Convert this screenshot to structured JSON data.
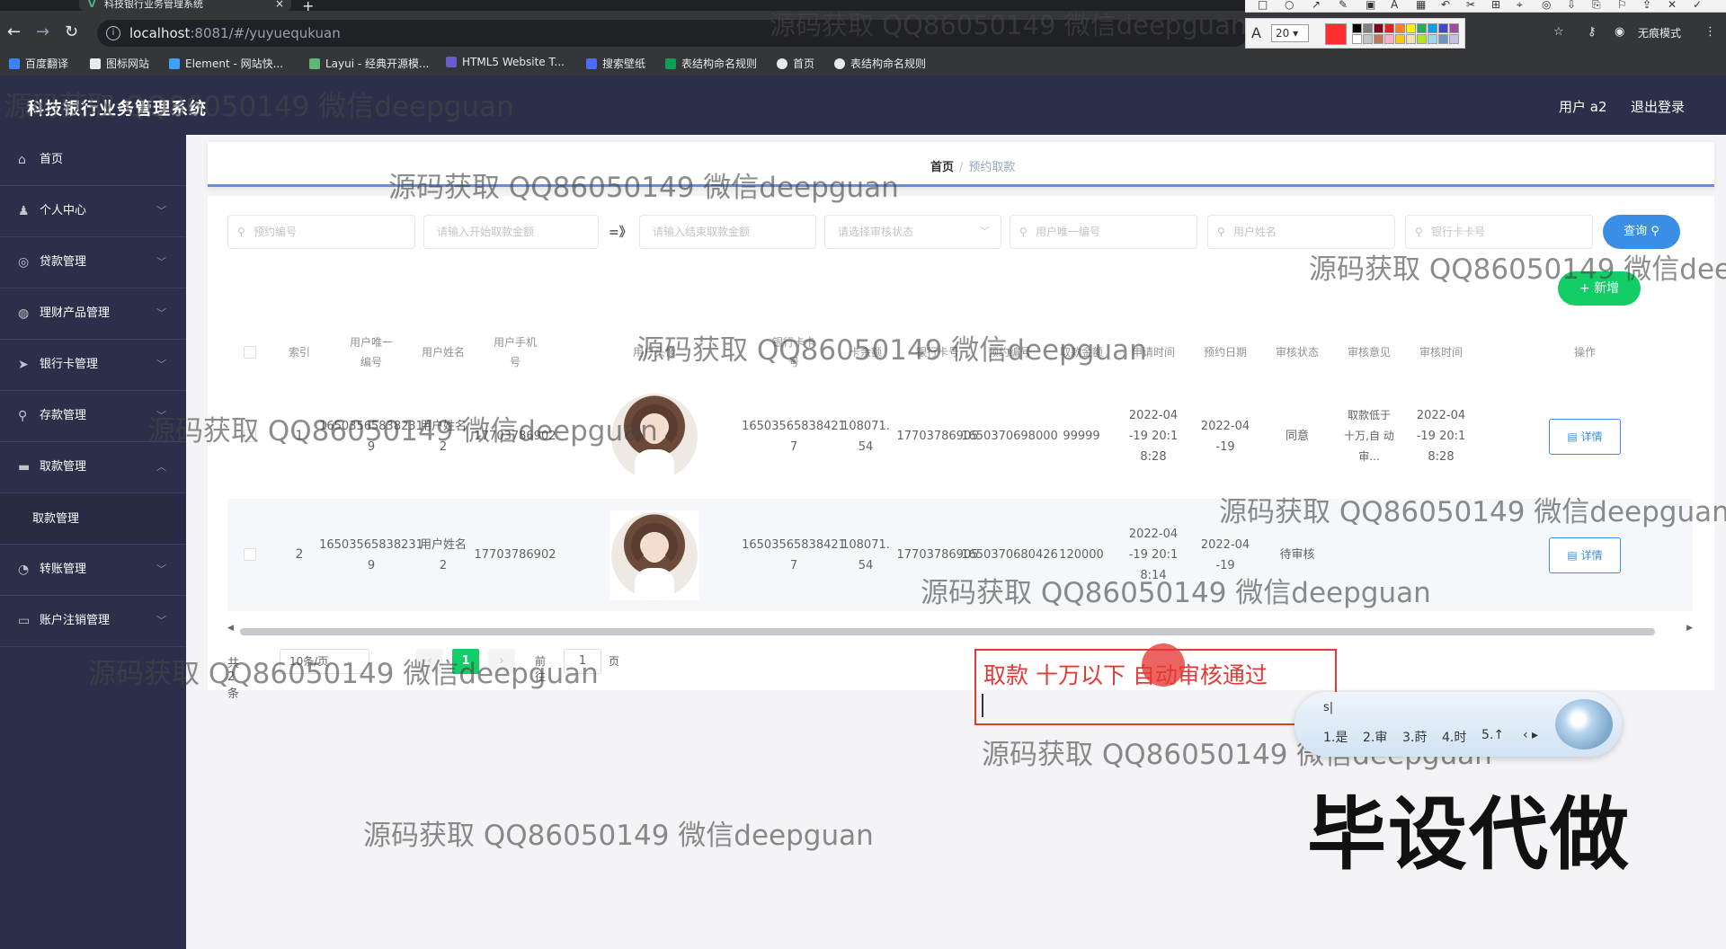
{
  "browser": {
    "tab_title": "科技银行业务管理系统",
    "tab_close": "×",
    "new_tab": "+",
    "url_host": "localhost",
    "url_rest": ":8081/#/yuyuequkuan",
    "incognito": "无痕模式",
    "bookmarks": [
      "百度翻译",
      "图标网站",
      "Element - 网站快...",
      "Layui - 经典开源模...",
      "HTML5 Website T...",
      "搜索壁纸",
      "表结构命名规则",
      "首页",
      "表结构命名规则"
    ],
    "draw_size": "20",
    "draw_color": "#ff2d2d",
    "palette": [
      "#000000",
      "#7f7f7f",
      "#880015",
      "#ed1c24",
      "#ff7f27",
      "#fff200",
      "#22b14c",
      "#00a2e8",
      "#3f48cc",
      "#a349a4",
      "#ffffff",
      "#c3c3c3",
      "#b97a57",
      "#ffaec9",
      "#ffc90e",
      "#efe4b0",
      "#b5e61d",
      "#99d9ea",
      "#7092be",
      "#c8bfe7"
    ]
  },
  "header": {
    "title": "科技银行业务管理系统",
    "user": "用户 a2",
    "logout": "退出登录"
  },
  "sidebar": {
    "items": [
      {
        "label": "首页",
        "icon": "home-icon"
      },
      {
        "label": "个人中心",
        "icon": "user-icon"
      },
      {
        "label": "贷款管理",
        "icon": "coin-icon"
      },
      {
        "label": "理财产品管理",
        "icon": "finance-icon"
      },
      {
        "label": "银行卡管理",
        "icon": "card-icon"
      },
      {
        "label": "存款管理",
        "icon": "deposit-icon"
      },
      {
        "label": "取款管理",
        "icon": "withdraw-icon",
        "expanded": true
      },
      {
        "label": "转账管理",
        "icon": "transfer-icon"
      },
      {
        "label": "账户注销管理",
        "icon": "close-account-icon"
      }
    ],
    "subitem": "取款管理"
  },
  "breadcrumb": {
    "home": "首页",
    "sep": "/",
    "current": "预约取款"
  },
  "search": {
    "booking_no": "预约编号",
    "amount_from": "请输入开始取款金额",
    "range_arrow": "=》",
    "amount_to": "请输入结束取款金额",
    "audit_status": "请选择审核状态",
    "user_no": "用户唯一编号",
    "user_name": "用户姓名",
    "card_no": "银行卡卡号",
    "query_button": "查询",
    "add_button": "+ 新增"
  },
  "table": {
    "columns": [
      "索引",
      "用户唯一编号",
      "用户姓名",
      "用户手机号",
      "用户头像",
      "银行卡卡号",
      "卡余额",
      "银行卡号",
      "预约编号",
      "取款金额",
      "申请时间",
      "预约日期",
      "审核状态",
      "审核意见",
      "审核时间",
      "操作"
    ],
    "rows": [
      {
        "index": "1",
        "user_no": "16503565838231 9",
        "name": "用户姓名2",
        "phone": "17703786902",
        "card": "16503565838421 7",
        "balance": "108071. 54",
        "card_phone": "17703786905",
        "booking_no": "1650370698000",
        "amount": "99999",
        "apply_time": "2022-04 -19 20:1 8:28",
        "book_date": "2022-04 -19",
        "status": "同意",
        "opinion": "取款低于 十万,自 动审...",
        "audit_time": "2022-04 -19 20:1 8:28",
        "action": "详情"
      },
      {
        "index": "2",
        "user_no": "16503565838231 9",
        "name": "用户姓名2",
        "phone": "17703786902",
        "card": "16503565838421 7",
        "balance": "108071. 54",
        "card_phone": "17703786905",
        "booking_no": "1650370680426",
        "amount": "120000",
        "apply_time": "2022-04 -19 20:1 8:14",
        "book_date": "2022-04 -19",
        "status": "待审核",
        "opinion": "",
        "audit_time": "",
        "action": "详情"
      }
    ]
  },
  "pagination": {
    "total": "共 2 条",
    "page_size": "10条/页",
    "prev": "‹",
    "current": "1",
    "next": "›",
    "goto_label": "前往",
    "goto_value": "1",
    "page_unit": "页"
  },
  "overlays": {
    "watermark": "源码获取 QQ86050149 微信deepguan",
    "annotation": "取款 十万以下 自动审核通过",
    "ime_input": "s|",
    "ime_candidates": [
      "1.是",
      "2.审",
      "3.莳",
      "4.时",
      "5.↑"
    ],
    "ad_text": "毕设代做"
  }
}
